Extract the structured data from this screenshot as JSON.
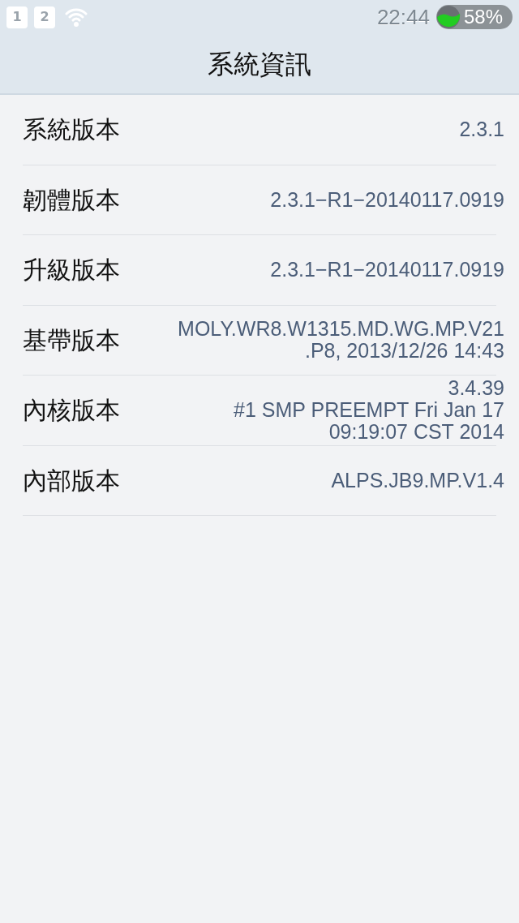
{
  "status_bar": {
    "sim_slots": [
      "1",
      "2"
    ],
    "time": "22:44",
    "battery": "58%"
  },
  "header": {
    "title": "系統資訊"
  },
  "rows": [
    {
      "label": "系統版本",
      "value": [
        "2.3.1"
      ]
    },
    {
      "label": "韌體版本",
      "value": [
        "2.3.1−R1−20140117.0919"
      ]
    },
    {
      "label": "升級版本",
      "value": [
        "2.3.1−R1−20140117.0919"
      ]
    },
    {
      "label": "基帶版本",
      "value": [
        "MOLY.WR8.W1315.MD.WG.MP.V21",
        ".P8, 2013/12/26 14:43"
      ]
    },
    {
      "label": "內核版本",
      "value": [
        "3.4.39",
        "#1 SMP PREEMPT Fri Jan 17",
        "09:19:07 CST 2014"
      ]
    },
    {
      "label": "內部版本",
      "value": [
        "ALPS.JB9.MP.V1.4"
      ]
    }
  ]
}
